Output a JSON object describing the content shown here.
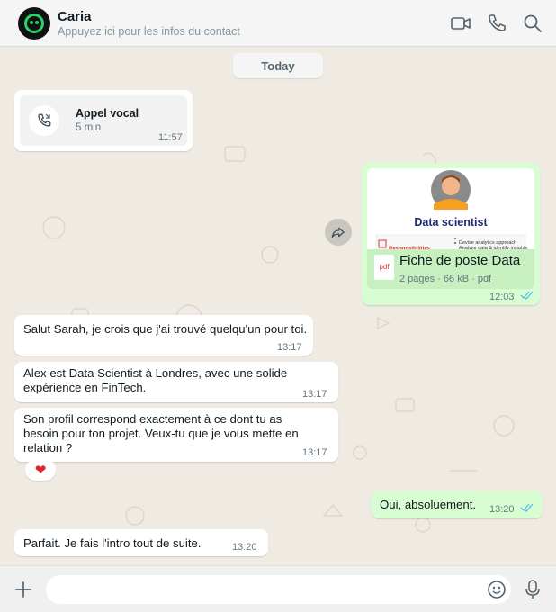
{
  "header": {
    "contact_name": "Caria",
    "subtitle": "Appuyez ici pour les infos du contact",
    "icons": [
      "video-call-icon",
      "voice-call-icon",
      "search-icon"
    ]
  },
  "chat": {
    "date_divider": "Today",
    "call": {
      "title": "Appel vocal",
      "duration": "5 min",
      "time": "11:57"
    },
    "document": {
      "preview_title": "Data scientist",
      "preview_section": "Responsibilities",
      "preview_bullets": [
        "Devise analytics approach",
        "Analyze data & identify insights"
      ],
      "file_type": "pdf",
      "name": "Fiche de poste Data",
      "meta": "2 pages · 66 kB · pdf",
      "time": "12:03"
    },
    "messages": [
      {
        "direction": "in",
        "lines": [
          "Salut Sarah, je crois que j'ai trouvé quelqu'un pour toi."
        ],
        "time": "13:17"
      },
      {
        "direction": "in",
        "lines": [
          "Alex est Data Scientist à Londres, avec une solide",
          "expérience en FinTech."
        ],
        "time": "13:17"
      },
      {
        "direction": "in",
        "lines": [
          "Son profil correspond exactement à ce dont tu as",
          "besoin pour ton projet. Veux-tu que je vous mette en",
          "relation ?"
        ],
        "time": "13:17",
        "reaction": "❤"
      },
      {
        "direction": "out",
        "lines": [
          "Oui, absoluement."
        ],
        "time": "13:20"
      },
      {
        "direction": "in",
        "lines": [
          "Parfait. Je fais l'intro tout de suite."
        ],
        "time": "13:20"
      }
    ]
  },
  "composer": {
    "placeholder": "",
    "value": ""
  },
  "colors": {
    "outgoing_bubble": "#d9fdd3",
    "incoming_bubble": "#ffffff",
    "chat_bg": "#efeae2",
    "read_tick": "#53bdeb",
    "brand_green": "#25d366"
  }
}
